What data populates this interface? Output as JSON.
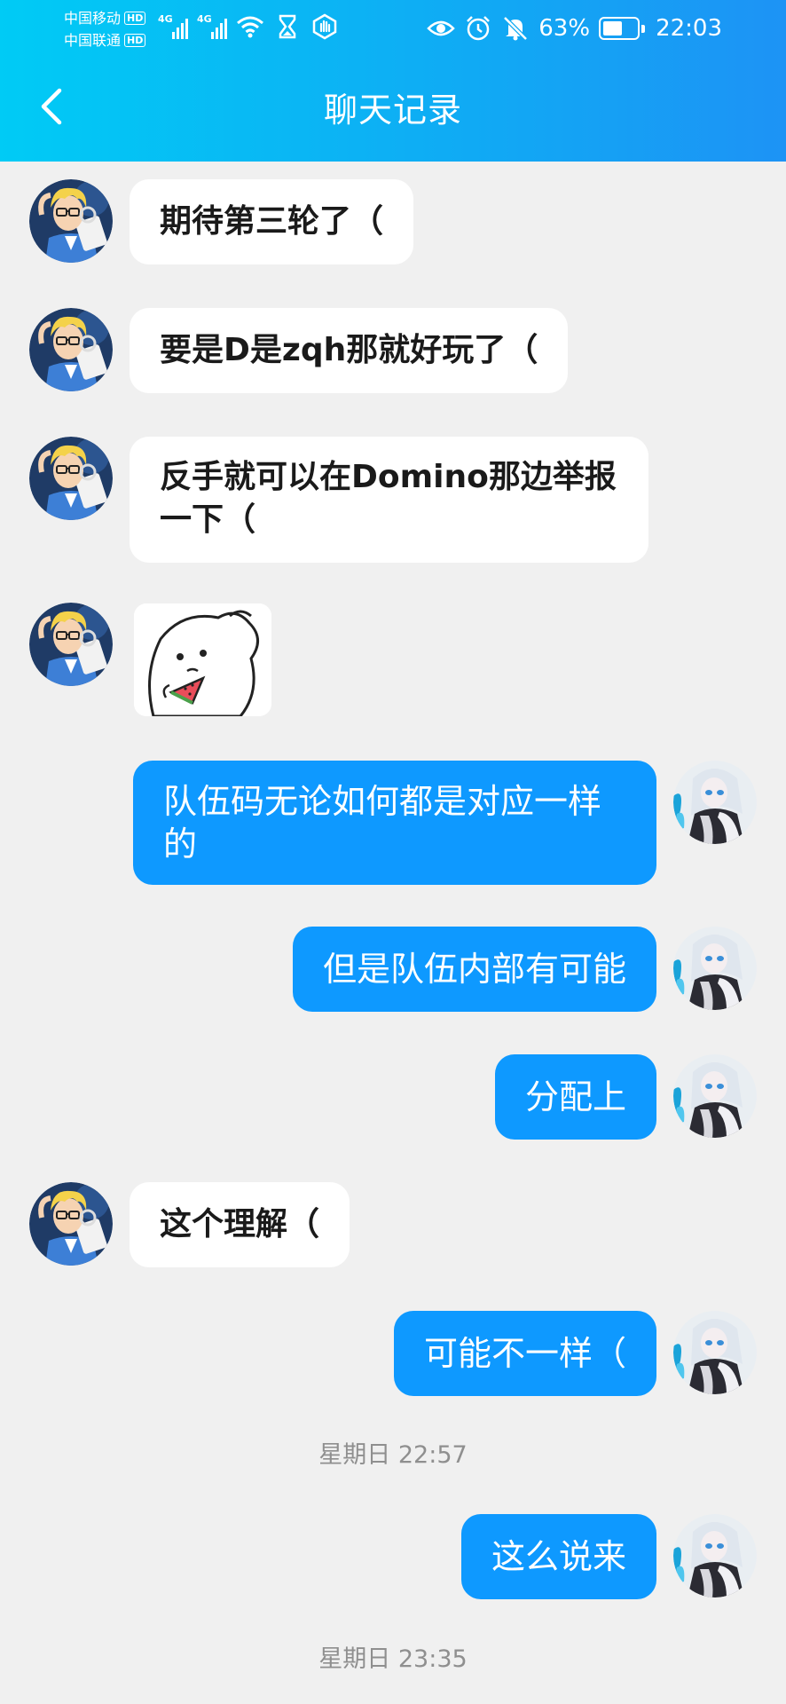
{
  "status_bar": {
    "carrier_1": "中国移动",
    "carrier_2": "中国联通",
    "hd_badge": "HD",
    "network_type": "4G",
    "battery_percent": "63%",
    "battery_level": 0.63,
    "time": "22:03",
    "icons": [
      "signal-icon",
      "wifi-icon",
      "hourglass-icon",
      "hand-icon",
      "eye-icon",
      "alarm-icon",
      "mute-bell-icon",
      "battery-icon"
    ]
  },
  "header": {
    "title": "聊天记录",
    "back_icon": "chevron-left-icon"
  },
  "colors": {
    "header_gradient_start": "#00cbf5",
    "header_gradient_end": "#1d93f5",
    "outgoing_bubble": "#0e99ff",
    "incoming_bubble": "#ffffff",
    "background": "#f0f0f0",
    "timestamp_text": "#8f8f8f"
  },
  "messages": [
    {
      "direction": "in",
      "text": "期待第三轮了（"
    },
    {
      "direction": "in",
      "text": "要是D是zqh那就好玩了（"
    },
    {
      "direction": "in",
      "text": "反手就可以在Domino那边举报一下（"
    },
    {
      "direction": "in",
      "type": "sticker",
      "sticker": "ghost-eating-watermelon-sticker"
    },
    {
      "direction": "out",
      "text": "队伍码无论如何都是对应一样的"
    },
    {
      "direction": "out",
      "text": "但是队伍内部有可能"
    },
    {
      "direction": "out",
      "text": "分配上"
    },
    {
      "direction": "in",
      "text": "这个理解（"
    },
    {
      "direction": "out",
      "text": "可能不一样（"
    },
    {
      "type": "timestamp",
      "text": "星期日 22:57"
    },
    {
      "direction": "out",
      "text": "这么说来"
    },
    {
      "type": "timestamp",
      "text": "星期日 23:35"
    }
  ]
}
